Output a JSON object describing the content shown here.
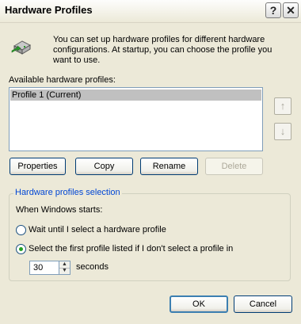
{
  "window": {
    "title": "Hardware Profiles",
    "help_glyph": "?",
    "close_glyph": "✕"
  },
  "info": {
    "text": "You can set up hardware profiles for different hardware configurations.  At startup, you can choose the profile you want to use."
  },
  "profiles": {
    "label": "Available hardware profiles:",
    "items": [
      {
        "label": "Profile 1 (Current)",
        "selected": true
      }
    ],
    "move_up_glyph": "↑",
    "move_down_glyph": "↓"
  },
  "buttons": {
    "properties": "Properties",
    "copy": "Copy",
    "rename": "Rename",
    "delete": "Delete"
  },
  "selection": {
    "group_title": "Hardware profiles selection",
    "when_label": "When Windows starts:",
    "option_wait": "Wait until I select a hardware profile",
    "option_first": "Select the first profile listed if I don't select a profile in",
    "selected_option": "option_first",
    "seconds_value": "30",
    "seconds_label": "seconds"
  },
  "footer": {
    "ok": "OK",
    "cancel": "Cancel"
  },
  "colors": {
    "accent": "#0046d5",
    "radio_dot": "#21a121",
    "dialog_bg": "#ece9d8"
  }
}
